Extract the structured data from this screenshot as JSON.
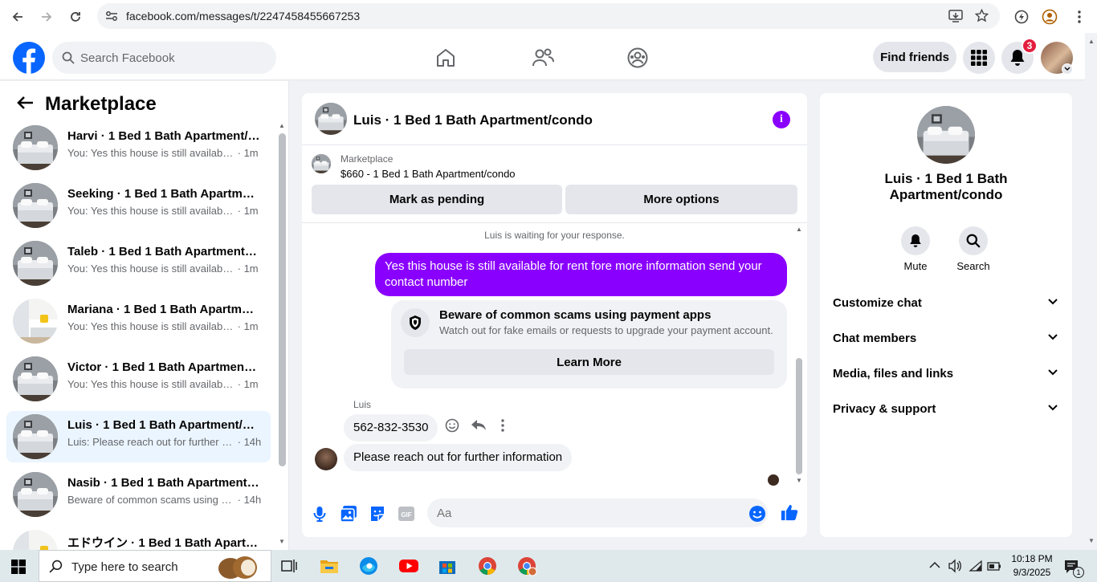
{
  "browser": {
    "url": "facebook.com/messages/t/2247458455667253"
  },
  "topbar": {
    "search_placeholder": "Search Facebook",
    "find_friends_label": "Find friends",
    "notification_count": "3",
    "brand_color": "#0866ff"
  },
  "left_panel": {
    "title": "Marketplace",
    "conversations": [
      {
        "title": "Harvi · 1 Bed 1 Bath Apartment/condo",
        "preview": "You: Yes this house is still available for rent",
        "time": "· 1m",
        "active": false
      },
      {
        "title": "Seeking · 1 Bed 1 Bath Apartment/condo",
        "preview": "You: Yes this house is still available for rent",
        "time": "· 1m",
        "active": false
      },
      {
        "title": "Taleb · 1 Bed 1 Bath Apartment/condo",
        "preview": "You: Yes this house is still available for rent",
        "time": "· 1m",
        "active": false
      },
      {
        "title": "Mariana · 1 Bed 1 Bath Apartment/condo",
        "preview": "You: Yes this house is still available for rent",
        "time": "· 1m",
        "active": false
      },
      {
        "title": "Victor · 1 Bed 1 Bath Apartment/condo",
        "preview": "You: Yes this house is still available for rent",
        "time": "· 1m",
        "active": false
      },
      {
        "title": "Luis · 1 Bed 1 Bath Apartment/condo",
        "preview": "Luis: Please reach out for further information",
        "time": "· 14h",
        "active": true
      },
      {
        "title": "Nasib · 1 Bed 1 Bath Apartment/condo",
        "preview": "Beware of common scams using payment apps",
        "time": "· 14h",
        "active": false
      },
      {
        "title": "エドウイン · 1 Bed 1 Bath Apartment/condo",
        "preview": "",
        "time": "",
        "active": false
      }
    ]
  },
  "chat": {
    "title": "Luis · 1 Bed 1 Bath Apartment/condo",
    "marketplace_label": "Marketplace",
    "listing": "$660 - 1 Bed 1 Bath Apartment/condo",
    "mark_pending_label": "Mark as pending",
    "more_options_label": "More options",
    "waiting_text": "Luis is waiting for your response.",
    "outgoing_message": "Yes this house is still available for rent fore more information send your contact number",
    "scam_title": "Beware of common scams using payment apps",
    "scam_text": "Watch out for fake emails or requests to upgrade your payment account.",
    "learn_more_label": "Learn More",
    "sender_name": "Luis",
    "incoming_messages": [
      "562-832-3530",
      "Please reach out for further information"
    ],
    "input_placeholder": "Aa",
    "accent_color": "#8a00ff"
  },
  "right_panel": {
    "title": "Luis · 1 Bed 1 Bath Apartment/condo",
    "mute_label": "Mute",
    "search_label": "Search",
    "sections": [
      "Customize chat",
      "Chat members",
      "Media, files and links",
      "Privacy & support"
    ]
  },
  "taskbar": {
    "search_placeholder": "Type here to search",
    "time": "10:18 PM",
    "date": "9/3/2025",
    "notification_count": "1"
  }
}
